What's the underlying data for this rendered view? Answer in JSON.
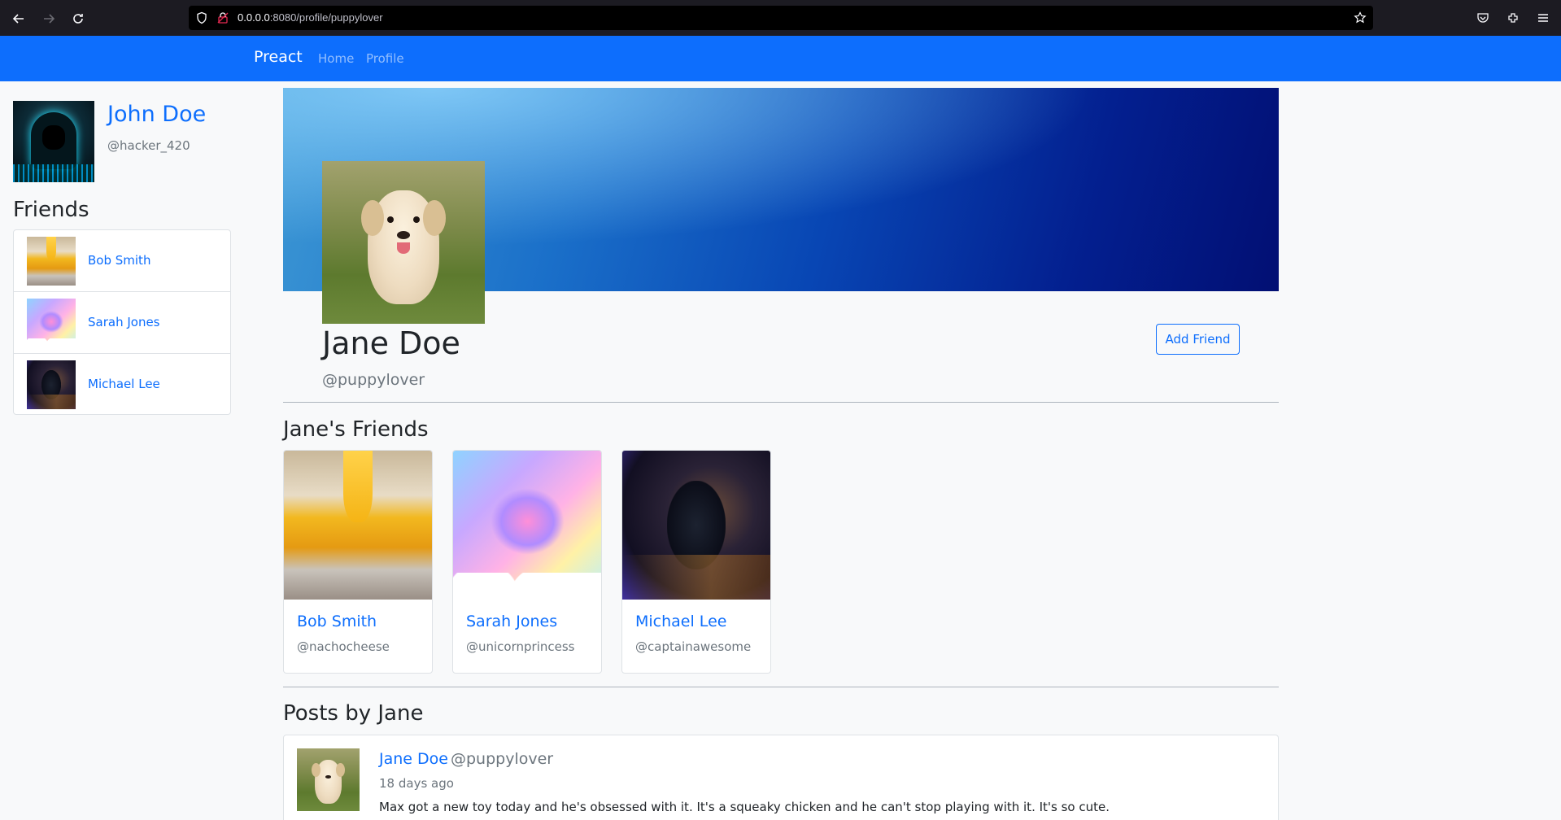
{
  "browser": {
    "url_host": "0.0.0.0",
    "url_rest": ":8080/profile/puppylover"
  },
  "navbar": {
    "brand": "Preact",
    "links": [
      "Home",
      "Profile"
    ]
  },
  "current_user": {
    "name": "John Doe",
    "handle": "@hacker_420"
  },
  "sidebar": {
    "friends_heading": "Friends",
    "friends": [
      {
        "name": "Bob Smith"
      },
      {
        "name": "Sarah Jones"
      },
      {
        "name": "Michael Lee"
      }
    ]
  },
  "profile": {
    "name": "Jane Doe",
    "handle": "@puppylover",
    "add_friend_label": "Add Friend"
  },
  "friends_section": {
    "title": "Jane's Friends",
    "cards": [
      {
        "name": "Bob Smith",
        "handle": "@nachocheese"
      },
      {
        "name": "Sarah Jones",
        "handle": "@unicornprincess"
      },
      {
        "name": "Michael Lee",
        "handle": "@captainawesome"
      }
    ]
  },
  "posts_section": {
    "title": "Posts by Jane",
    "posts": [
      {
        "author": "Jane Doe",
        "handle": "@puppylover",
        "time": "18 days ago",
        "text": "Max got a new toy today and he's obsessed with it. It's a squeaky chicken and he can't stop playing with it. It's so cute."
      }
    ]
  },
  "colors": {
    "primary": "#0d6efd",
    "muted": "#6c757d",
    "chrome_bg": "#1c1b22"
  }
}
